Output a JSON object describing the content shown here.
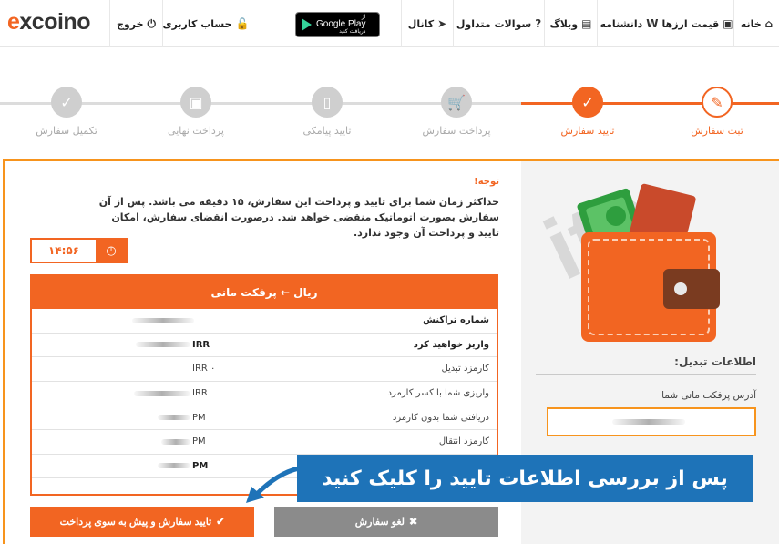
{
  "nav": {
    "logo": "excoino",
    "items": [
      {
        "label": "خانه",
        "icon": "home-icon",
        "glyph": "⌂"
      },
      {
        "label": "قیمت ارزها",
        "icon": "money-icon",
        "glyph": "▣"
      },
      {
        "label": "دانشنامه",
        "icon": "wikipedia-icon",
        "glyph": "W"
      },
      {
        "label": "وبلاگ",
        "icon": "newspaper-icon",
        "glyph": "▤"
      },
      {
        "label": "سوالات متداول",
        "icon": "question-icon",
        "glyph": "?"
      },
      {
        "label": "کانال",
        "icon": "telegram-icon",
        "glyph": "➤"
      },
      {
        "label": "حساب کاربری",
        "icon": "lock-icon",
        "glyph": "🔓"
      },
      {
        "label": "خروج",
        "icon": "power-icon",
        "glyph": "⏻"
      }
    ],
    "google_play": {
      "small": "از",
      "big": "Google Play",
      "small2": "دریافت کنید"
    }
  },
  "steps": [
    {
      "label": "ثبت سفارش",
      "state": "done",
      "glyph": "✎",
      "icon": "edit-icon"
    },
    {
      "label": "تایید سفارش",
      "state": "active",
      "glyph": "✓",
      "icon": "check-circle-icon"
    },
    {
      "label": "پرداخت سفارش",
      "state": "todo",
      "glyph": "🛒",
      "icon": "cart-icon"
    },
    {
      "label": "تایید پیامکی",
      "state": "todo",
      "glyph": "▯",
      "icon": "mobile-icon"
    },
    {
      "label": "پرداخت نهایی",
      "state": "todo",
      "glyph": "▣",
      "icon": "money-icon"
    },
    {
      "label": "تکمیل سفارش",
      "state": "todo",
      "glyph": "✓",
      "icon": "check-icon"
    }
  ],
  "notice": {
    "title": "توجه!",
    "body": "حداکثر زمان شما برای تایید و پرداخت این سفارش، ۱۵ دقیقه می باشد. پس از آن سفارش بصورت اتوماتیک منقضی خواهد شد. درصورت انقضای سفارش، امکان تایید و پرداخت آن وجود ندارد."
  },
  "timer": {
    "value": "۱۴:۵۶"
  },
  "transaction": {
    "title": "ریال ← پرفکت مانی",
    "rows": [
      {
        "label": "شماره تراکنش",
        "prefix": "",
        "bold": true
      },
      {
        "label": "واریز خواهید کرد",
        "prefix": "IRR",
        "bold": true
      },
      {
        "label": "کارمزد تبدیل",
        "prefix": "IRR ۰",
        "bold": false
      },
      {
        "label": "واریزی شما با کسر کارمزد",
        "prefix": "IRR",
        "bold": false
      },
      {
        "label": "دریافتی شما بدون کارمزد",
        "prefix": "PM",
        "bold": false
      },
      {
        "label": "کارمزد انتقال",
        "prefix": "PM",
        "bold": false
      },
      {
        "label": "",
        "prefix": "PM",
        "bold": true
      }
    ]
  },
  "exchange_info": {
    "title": "اطلاعات تبدیل:",
    "address_label": "آدرس پرفکت مانی شما"
  },
  "buttons": {
    "cancel": "لغو سفارش",
    "confirm": "تایید سفارش و پیش به سوی پرداخت"
  },
  "annotation": "پس از بررسی اطلاعات تایید را کلیک کنید",
  "watermark": "itn",
  "colors": {
    "accent": "#f26522",
    "border": "#f7941d",
    "banner": "#1e73b8",
    "cancel": "#8b8b8b"
  }
}
